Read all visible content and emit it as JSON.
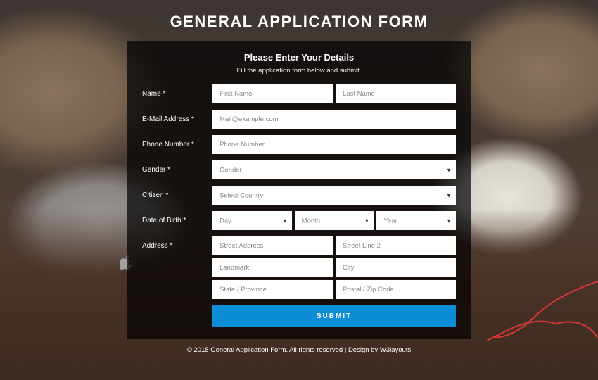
{
  "title": "GENERAL APPLICATION FORM",
  "subtitle": "Please Enter Your Details",
  "instruction": "Fill the application form below and submit.",
  "labels": {
    "name": "Name *",
    "email": "E-Mail Address *",
    "phone": "Phone Number *",
    "gender": "Gender *",
    "citizen": "Citizen *",
    "dob": "Date of Birth *",
    "address": "Address *"
  },
  "placeholders": {
    "firstName": "First Name",
    "lastName": "Last Name",
    "email": "Mail@example.com",
    "phone": "Phone Number",
    "gender": "Gender",
    "country": "Select Country",
    "day": "Day",
    "month": "Month",
    "year": "Year",
    "street": "Street Address",
    "street2": "Street Line 2",
    "landmark": "Landmark",
    "city": "City",
    "state": "State / Province",
    "postal": "Postal / Zip Code"
  },
  "submit": "SUBMIT",
  "footer": {
    "text": "© 2018 General Application Form. All rights reserved | Design by ",
    "link": "W3layouts"
  }
}
